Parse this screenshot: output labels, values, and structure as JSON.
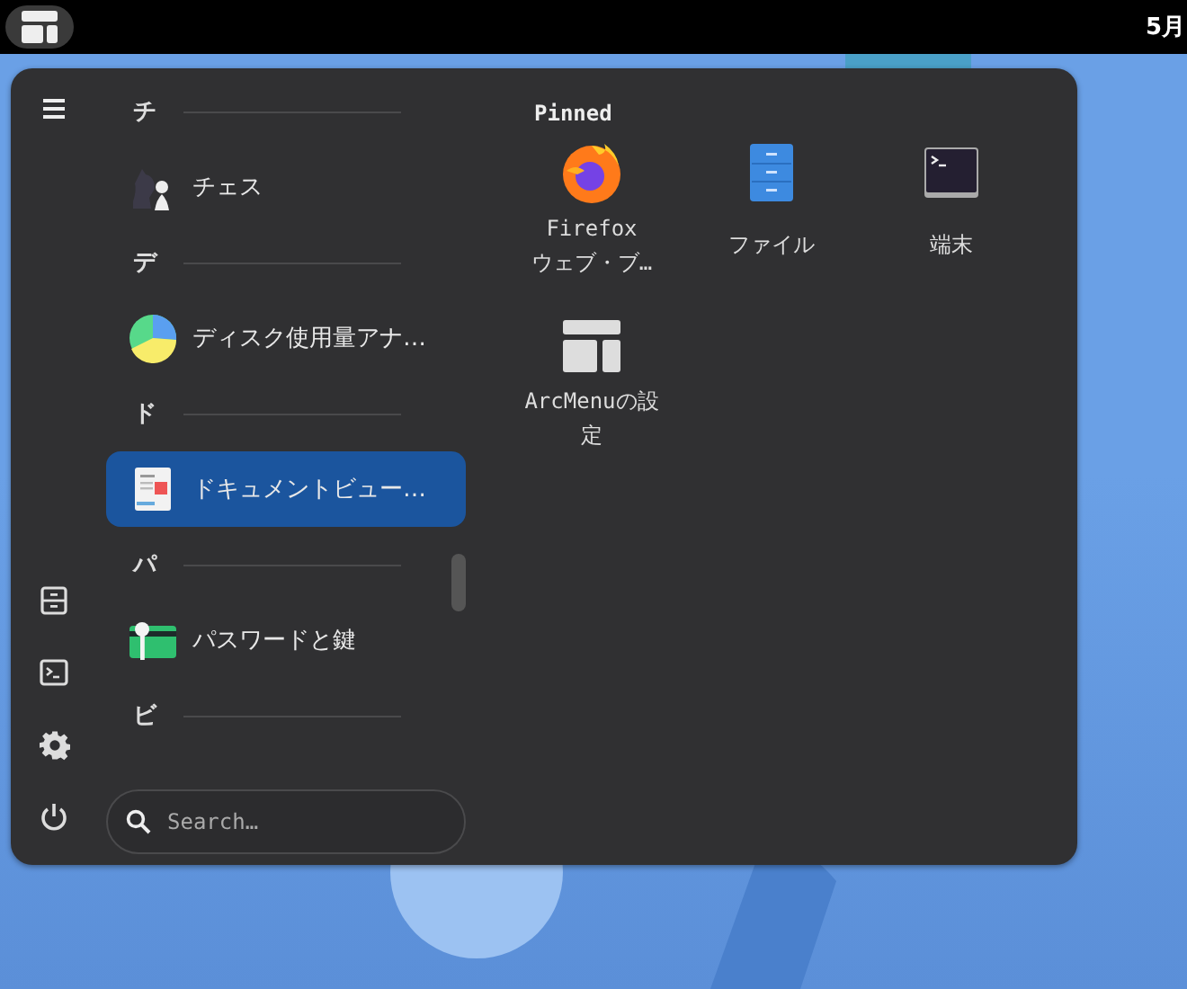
{
  "top_bar": {
    "clock": "5月"
  },
  "app_list": [
    {
      "letter": "チ",
      "apps": [
        {
          "name": "チェス",
          "selected": false
        }
      ]
    },
    {
      "letter": "デ",
      "apps": [
        {
          "name": "ディスク使用量アナ…",
          "selected": false
        }
      ]
    },
    {
      "letter": "ド",
      "apps": [
        {
          "name": "ドキュメントビュー…",
          "selected": true
        }
      ]
    },
    {
      "letter": "パ",
      "apps": [
        {
          "name": "パスワードと鍵",
          "selected": false
        }
      ]
    },
    {
      "letter": "ビ"
    }
  ],
  "search": {
    "placeholder": "Search…"
  },
  "pinned": {
    "title": "Pinned",
    "apps": [
      {
        "label": "Firefox\nウェブ・ブ…"
      },
      {
        "label": "ファイル"
      },
      {
        "label": "端末"
      },
      {
        "label": "ArcMenuの設定"
      }
    ]
  }
}
